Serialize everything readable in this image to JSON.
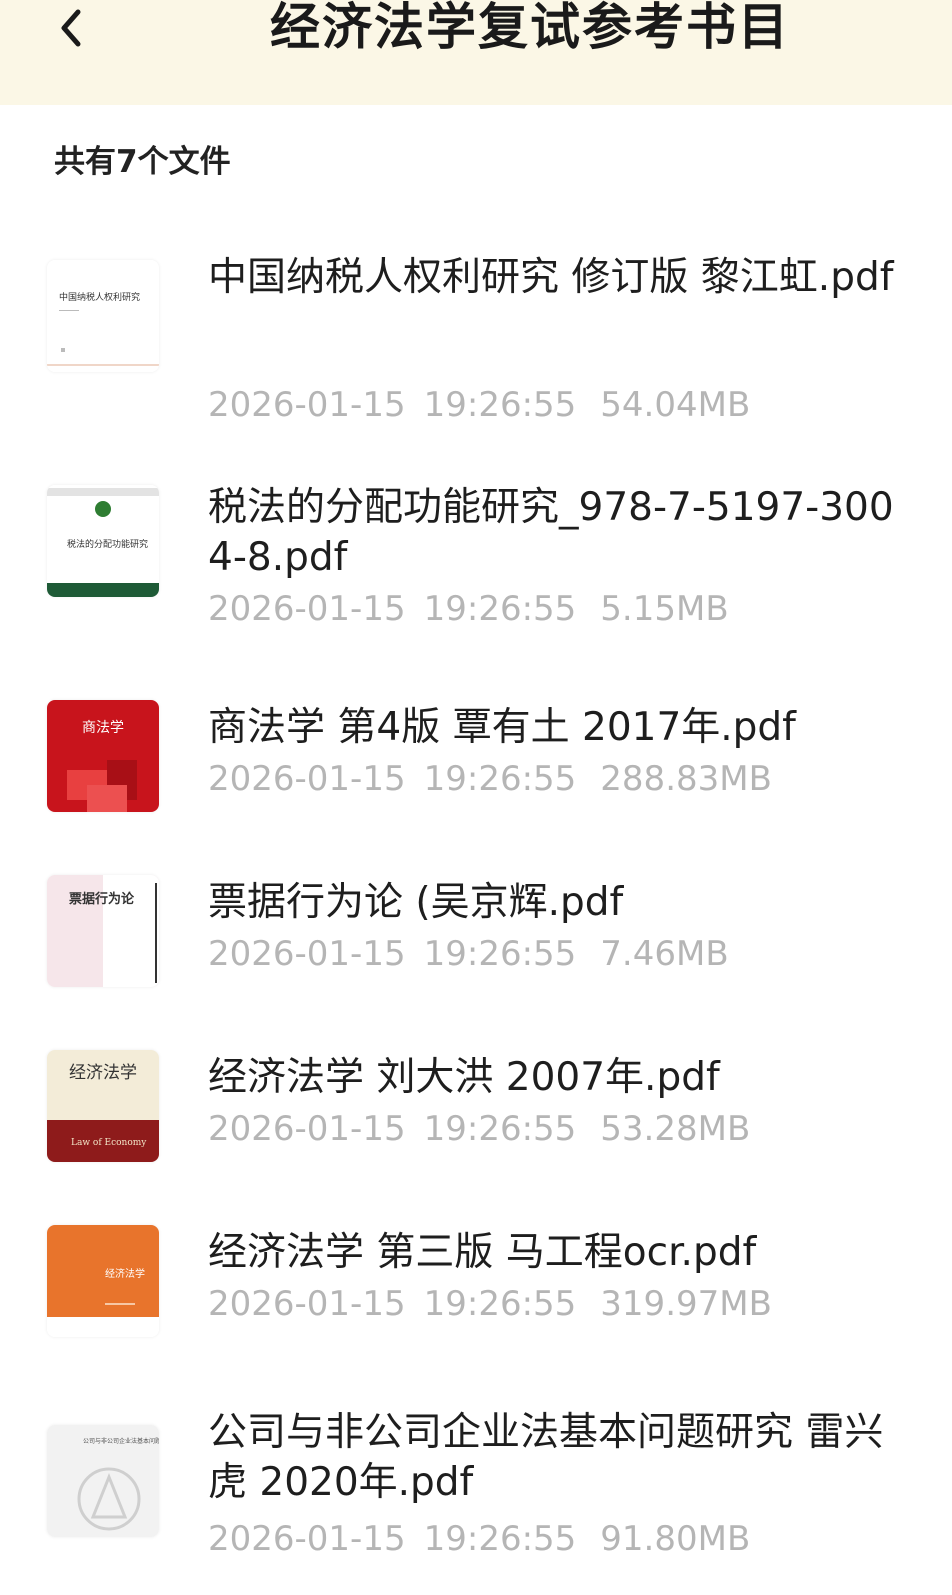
{
  "header": {
    "title": "经济法学复试参考书目",
    "back_icon": "chevron-left-icon",
    "background": "#fbf7e6"
  },
  "file_count_label": "共有7个文件",
  "files": [
    {
      "name": "中国纳税人权利研究 修订版 黎江虹.pdf",
      "date": "2026-01-15",
      "time": "19:26:55",
      "size": "54.04MB",
      "thumb": {
        "cover_title": "中国纳税人权利研究",
        "colors": [
          "#ffffff",
          "#f0d6c8"
        ]
      }
    },
    {
      "name": "税法的分配功能研究_978-7-5197-3004-8.pdf",
      "date": "2026-01-15",
      "time": "19:26:55",
      "size": "5.15MB",
      "thumb": {
        "cover_title": "税法的分配功能研究",
        "colors": [
          "#ffffff",
          "#1e5a36"
        ]
      }
    },
    {
      "name": "商法学 第4版 覃有土 2017年.pdf",
      "date": "2026-01-15",
      "time": "19:26:55",
      "size": "288.83MB",
      "thumb": {
        "cover_title": "商法学",
        "colors": [
          "#c8141c",
          "#e84040"
        ]
      }
    },
    {
      "name": "票据行为论 (吴京辉.pdf",
      "date": "2026-01-15",
      "time": "19:26:55",
      "size": "7.46MB",
      "thumb": {
        "cover_title": "票据行为论",
        "colors": [
          "#f6e6ea",
          "#ffffff"
        ]
      }
    },
    {
      "name": "经济法学 刘大洪 2007年.pdf",
      "date": "2026-01-15",
      "time": "19:26:55",
      "size": "53.28MB",
      "thumb": {
        "cover_title": "经济法学",
        "cover_subtitle": "Law of Economy",
        "colors": [
          "#f3ecd8",
          "#8e1b1b"
        ]
      }
    },
    {
      "name": "经济法学 第三版 马工程ocr.pdf",
      "date": "2026-01-15",
      "time": "19:26:55",
      "size": "319.97MB",
      "thumb": {
        "cover_title": "经济法学",
        "colors": [
          "#e8742c",
          "#ffffff"
        ]
      }
    },
    {
      "name": "公司与非公司企业法基本问题研究 雷兴虎 2020年.pdf",
      "date": "2026-01-15",
      "time": "19:26:55",
      "size": "91.80MB",
      "thumb": {
        "cover_title": "公司与非公司企业法基本问题研究",
        "colors": [
          "#f2f2f2",
          "#cfcfcf"
        ]
      }
    }
  ]
}
